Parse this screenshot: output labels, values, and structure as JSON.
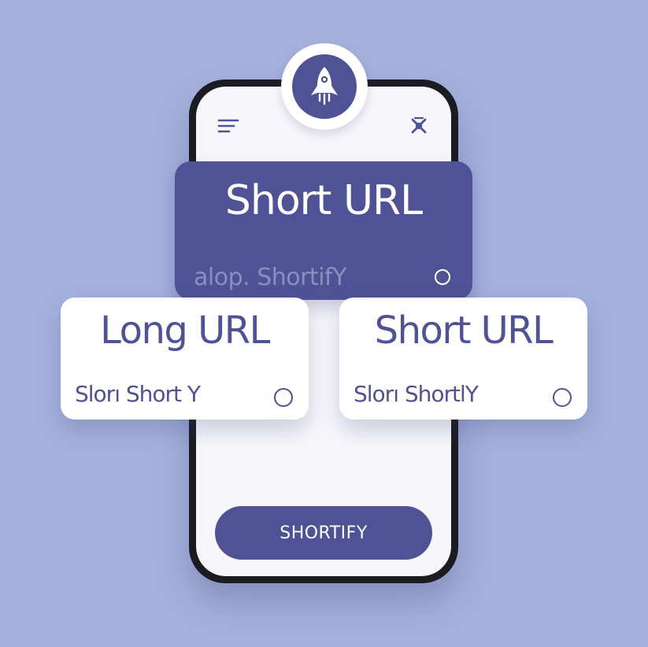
{
  "colors": {
    "background": "#a5b1dd",
    "accent": "#4f5294",
    "surface": "#ffffff",
    "muted_text": "#8b8ec0"
  },
  "logo": {
    "icon": "rocket-icon"
  },
  "header": {
    "menu_icon": "hamburger-menu-icon",
    "close_icon": "close-icon"
  },
  "hero": {
    "title": "Short URL",
    "subtitle": "alop. ShortifY"
  },
  "cards": [
    {
      "title": "Long URL",
      "subtitle": "Slorı Short Y"
    },
    {
      "title": "Short URL",
      "subtitle": "Slorı ShortlY"
    }
  ],
  "cta": {
    "label": "SHORTIFY"
  }
}
